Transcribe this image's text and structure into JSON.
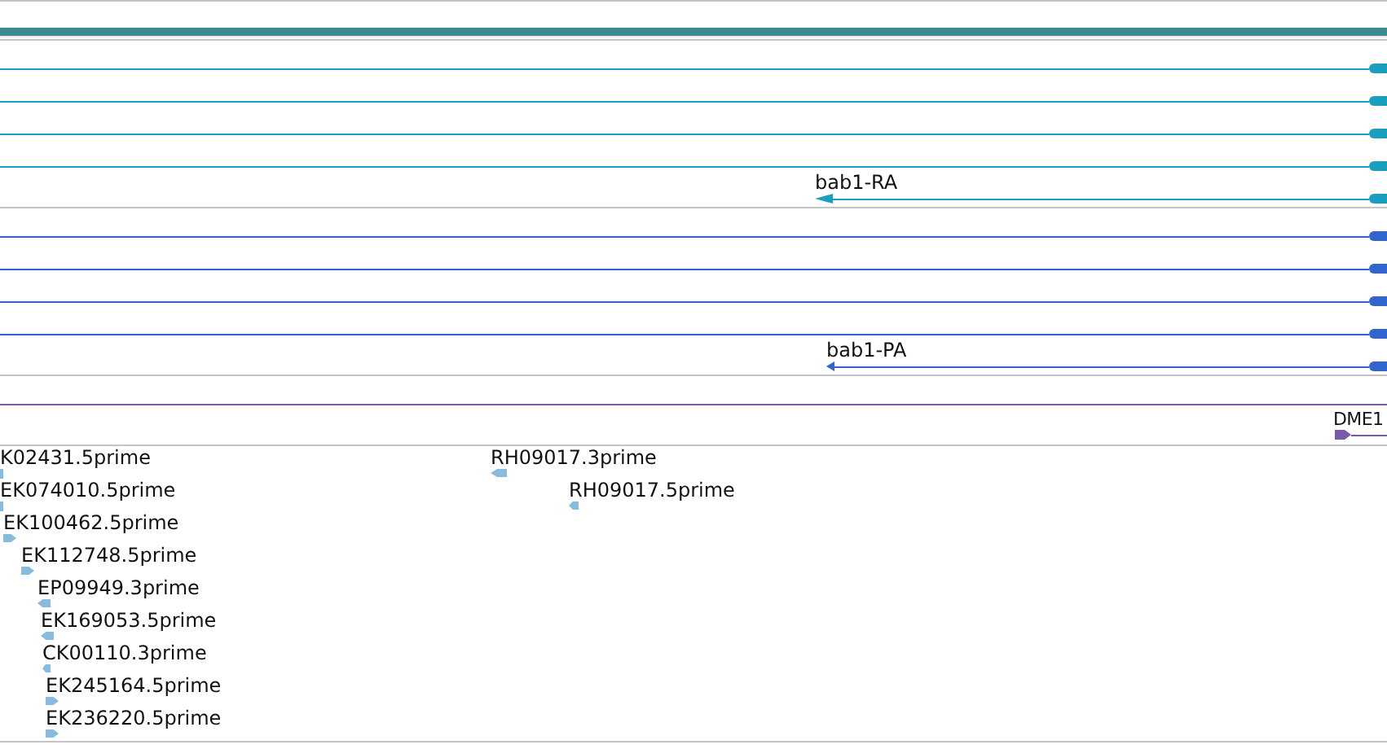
{
  "transcripts": [
    {
      "reverse": true
    },
    {
      "reverse": true
    },
    {
      "reverse": true
    },
    {
      "reverse": true
    },
    {
      "label": "bab1-RA",
      "reverse": true
    }
  ],
  "proteins": [
    {
      "reverse": true
    },
    {
      "reverse": true
    },
    {
      "reverse": true
    },
    {
      "reverse": true
    },
    {
      "label": "bab1-PA",
      "reverse": true
    }
  ],
  "regions": [
    {
      "kind": "span"
    },
    {
      "kind": "feature",
      "label": "DME1",
      "reverse": false
    }
  ],
  "ests": [
    [
      {
        "label": "K02431.5prime"
      },
      {
        "label": "RH09017.3prime",
        "reverse": true
      }
    ],
    [
      {
        "label": "EK074010.5prime"
      },
      {
        "label": "RH09017.5prime",
        "reverse": true
      }
    ],
    [
      {
        "label": "EK100462.5prime",
        "reverse": false
      }
    ],
    [
      {
        "label": "EK112748.5prime",
        "reverse": false
      }
    ],
    [
      {
        "label": "EP09949.3prime",
        "reverse": true
      }
    ],
    [
      {
        "label": "EK169053.5prime",
        "reverse": true
      }
    ],
    [
      {
        "label": "CK00110.3prime",
        "reverse": true
      }
    ],
    [
      {
        "label": "EK245164.5prime",
        "reverse": false
      }
    ],
    [
      {
        "label": "EK236220.5prime",
        "reverse": false
      }
    ]
  ]
}
